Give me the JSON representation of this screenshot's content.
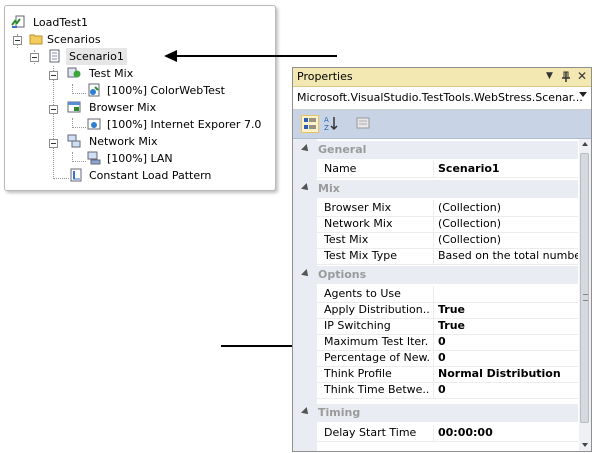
{
  "tree": {
    "root": "LoadTest1",
    "scenarios": "Scenarios",
    "scenario1": "Scenario1",
    "test_mix": "Test Mix",
    "test_mix_item": "[100%] ColorWebTest",
    "browser_mix": "Browser Mix",
    "browser_mix_item": "[100%] Internet Exporer 7.0",
    "network_mix": "Network Mix",
    "network_mix_item": "[100%] LAN",
    "load_pattern": "Constant Load Pattern"
  },
  "properties": {
    "title": "Properties",
    "pin_glyph": "▾ ⊥ ✕",
    "object": "Microsoft.VisualStudio.TestTools.WebStress.Scenar...",
    "categories": {
      "general": "General",
      "mix": "Mix",
      "options": "Options",
      "timing": "Timing"
    },
    "rows": {
      "name": {
        "label": "Name",
        "value": "Scenario1"
      },
      "browser_mix": {
        "label": "Browser Mix",
        "value": "(Collection)"
      },
      "network_mix": {
        "label": "Network Mix",
        "value": "(Collection)"
      },
      "test_mix": {
        "label": "Test Mix",
        "value": "(Collection)"
      },
      "test_mix_type": {
        "label": "Test Mix Type",
        "value": "Based on the total number"
      },
      "agents": {
        "label": "Agents to Use",
        "value": ""
      },
      "apply_dist": {
        "label": "Apply Distribution...",
        "value": "True"
      },
      "ip_switching": {
        "label": "IP Switching",
        "value": "True"
      },
      "max_iter": {
        "label": "Maximum Test Iter...",
        "value": "0"
      },
      "pct_new": {
        "label": "Percentage of New...",
        "value": "0"
      },
      "think_profile": {
        "label": "Think Profile",
        "value": "Normal Distribution"
      },
      "think_time": {
        "label": "Think Time Betwe...",
        "value": "0"
      },
      "delay_start": {
        "label": "Delay Start Time",
        "value": "00:00:00"
      }
    }
  }
}
